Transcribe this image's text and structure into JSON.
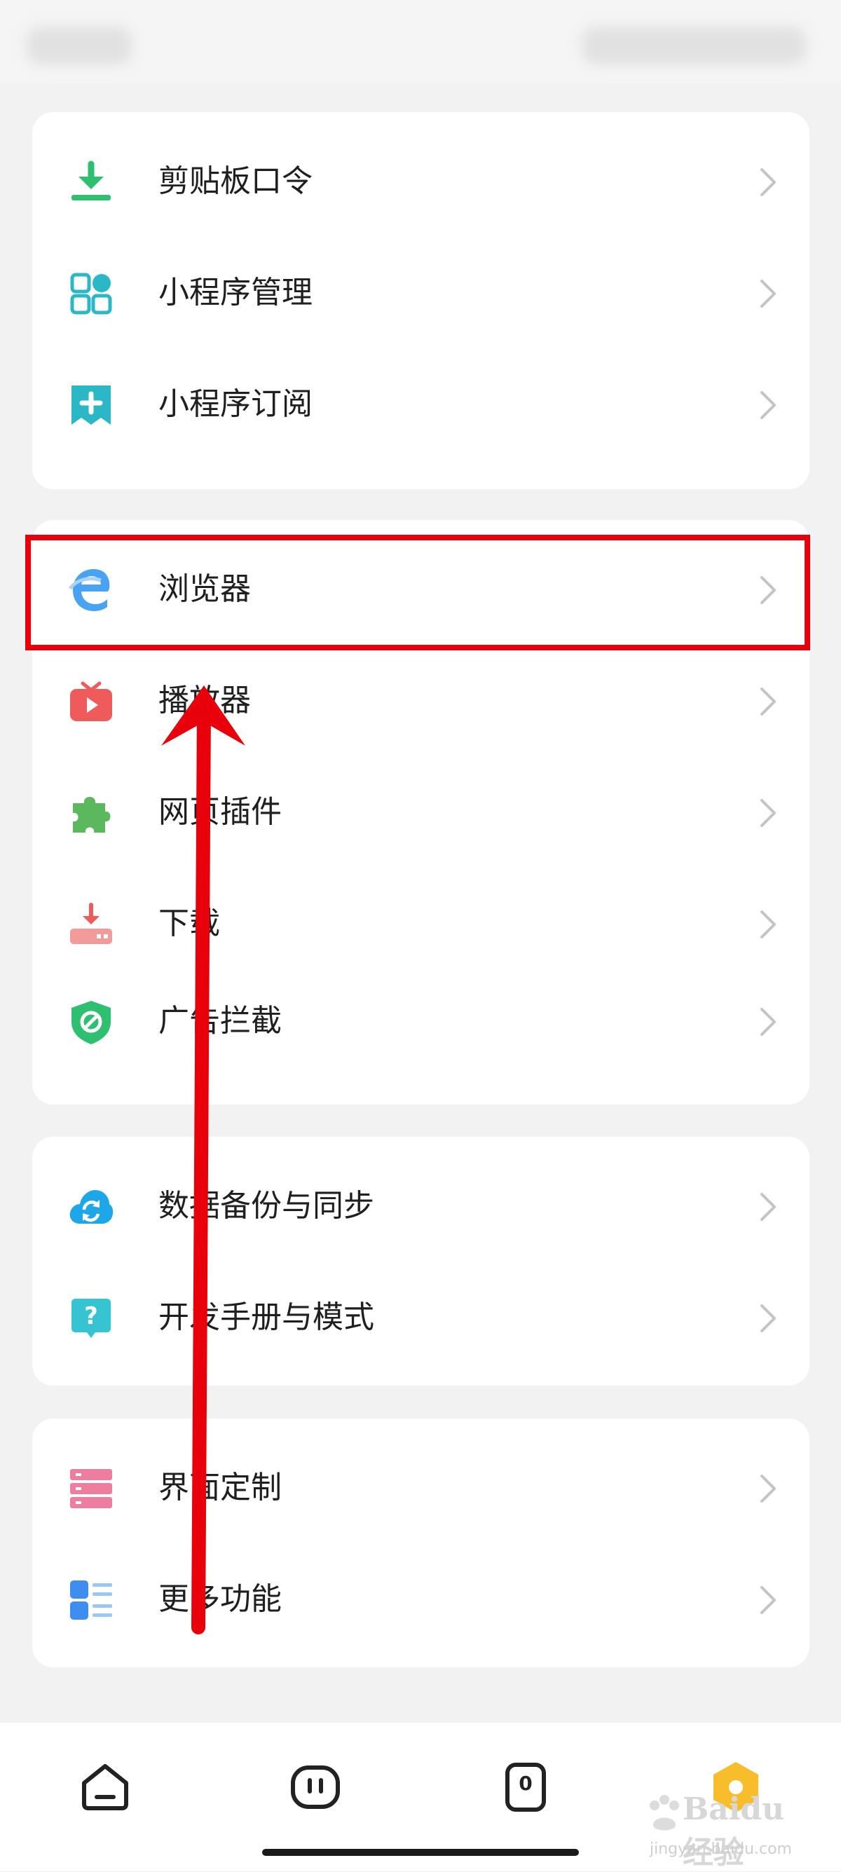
{
  "menu": {
    "group1": [
      {
        "label": "剪贴板口令",
        "icon": "clipboard-download-icon"
      },
      {
        "label": "小程序管理",
        "icon": "app-grid-icon"
      },
      {
        "label": "小程序订阅",
        "icon": "bookmark-plus-icon"
      }
    ],
    "group2": [
      {
        "label": "浏览器",
        "icon": "browser-e-icon"
      },
      {
        "label": "播放器",
        "icon": "tv-play-icon"
      },
      {
        "label": "网页插件",
        "icon": "puzzle-icon"
      },
      {
        "label": "下载",
        "icon": "download-tray-icon"
      },
      {
        "label": "广告拦截",
        "icon": "shield-block-icon"
      }
    ],
    "group3": [
      {
        "label": "数据备份与同步",
        "icon": "cloud-sync-icon"
      },
      {
        "label": "开发手册与模式",
        "icon": "help-bubble-icon"
      }
    ],
    "group4": [
      {
        "label": "界面定制",
        "icon": "layout-stack-icon"
      },
      {
        "label": "更多功能",
        "icon": "list-icon"
      }
    ]
  },
  "tabbar": {
    "tabs": [
      {
        "icon": "home-icon"
      },
      {
        "icon": "robot-face-icon"
      },
      {
        "icon": "tab-count-icon",
        "badge": "0"
      },
      {
        "icon": "profile-hexagon-icon"
      }
    ]
  },
  "watermark": {
    "text": "Baidu经验",
    "subtext": "jingyan.baidu.com"
  },
  "colors": {
    "highlight": "#e8000b",
    "arrow": "#e8000b",
    "green": "#2fbf71",
    "teal": "#2bb7c6",
    "blue": "#4aa3f2",
    "red": "#ef5b5b",
    "pink": "#ee7ea0"
  }
}
